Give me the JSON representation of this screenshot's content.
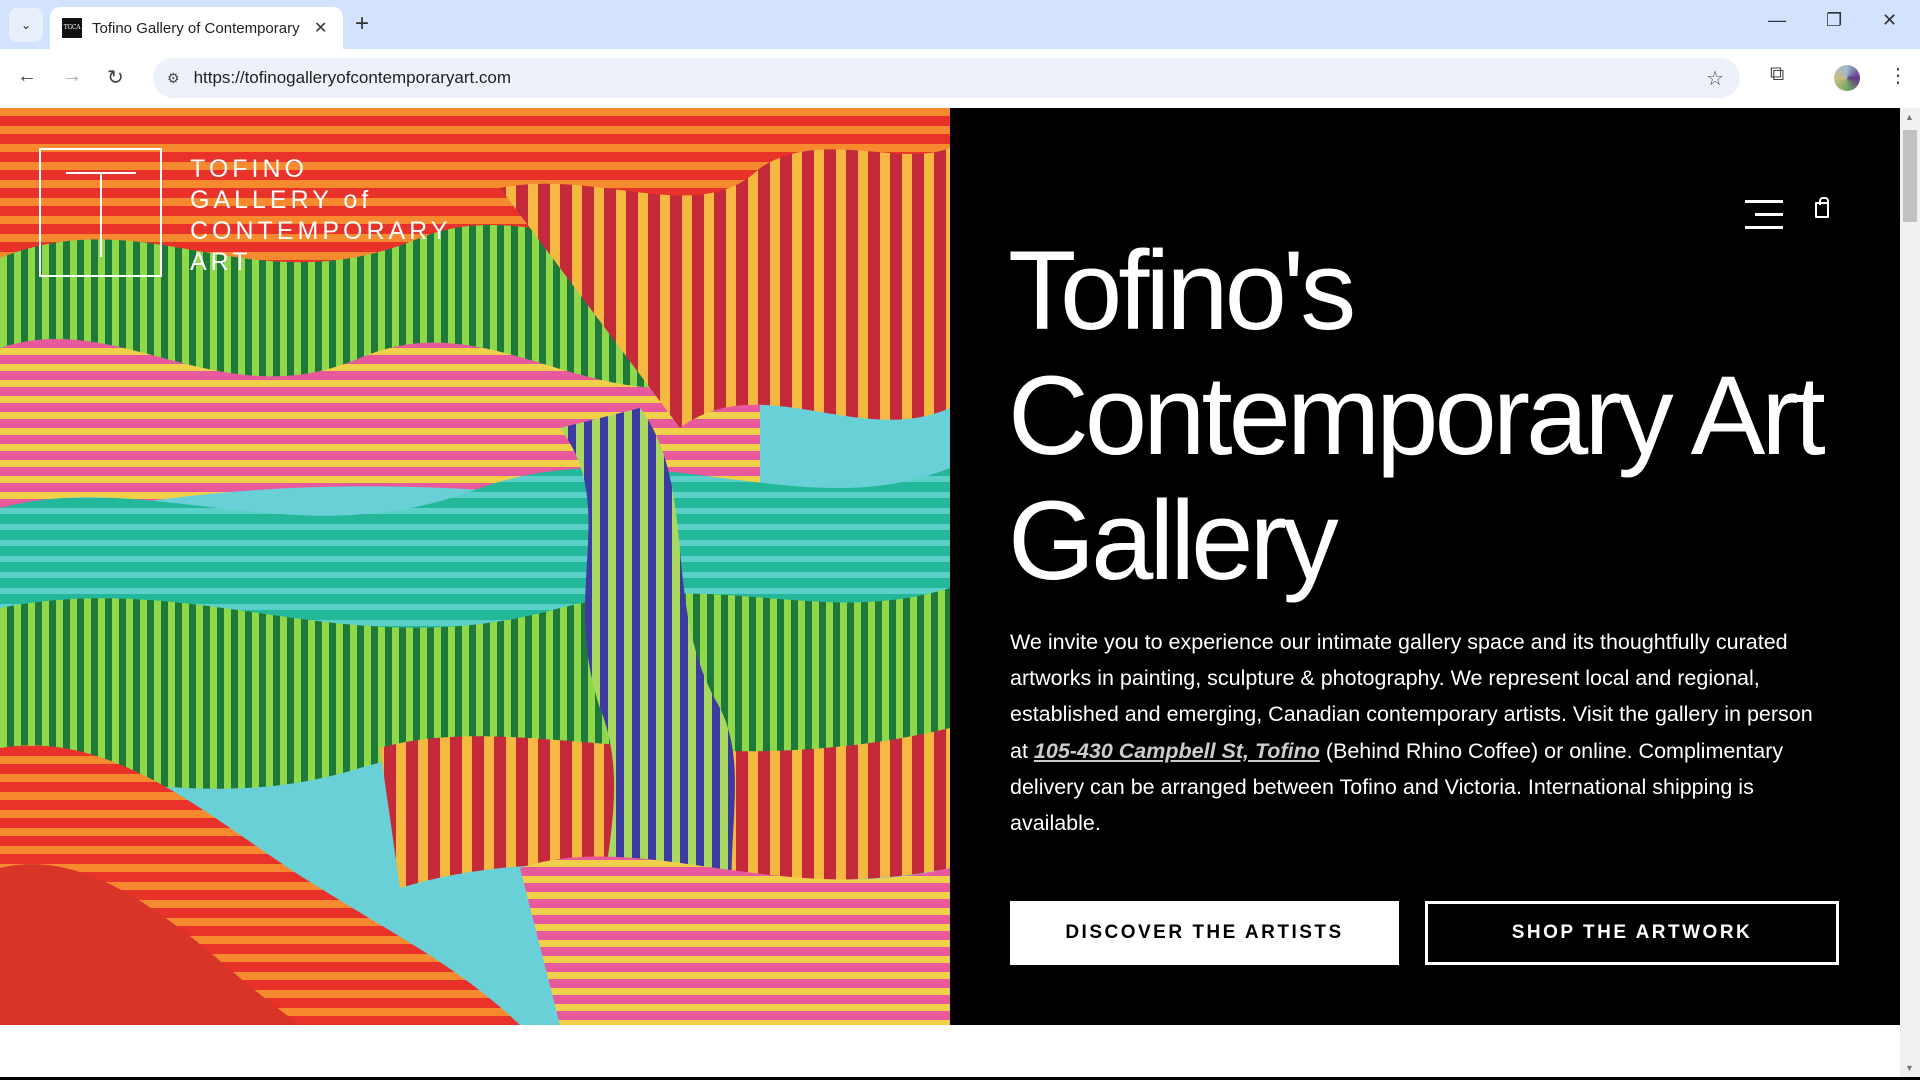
{
  "browser": {
    "tab_title": "Tofino Gallery of Contemporary Art",
    "url": "https://tofinogalleryofcontemporaryart.com",
    "favicon_text": "TGCA"
  },
  "logo": {
    "lines": [
      "TOFINO",
      "GALLERY of",
      "CONTEMPORARY",
      "ART"
    ],
    "mark": "T"
  },
  "hero": {
    "headline_lines": [
      "Tofino's",
      "Contemporary Art",
      "Gallery"
    ],
    "para_1": "We invite you to experience our intimate gallery space and its thoughtfully curated artworks in painting, sculpture & photography. We represent local and regional, established and emerging, Canadian contemporary artists.  Visit the gallery in person at ",
    "address_link": "105-430 Campbell St, Tofino",
    "para_2": " (Behind Rhino Coffee) or online. Complimentary delivery can be arranged between Tofino and Victoria. International shipping is available.",
    "buttons": {
      "discover": "DISCOVER THE ARTISTS",
      "shop": "SHOP THE ARTWORK"
    }
  }
}
